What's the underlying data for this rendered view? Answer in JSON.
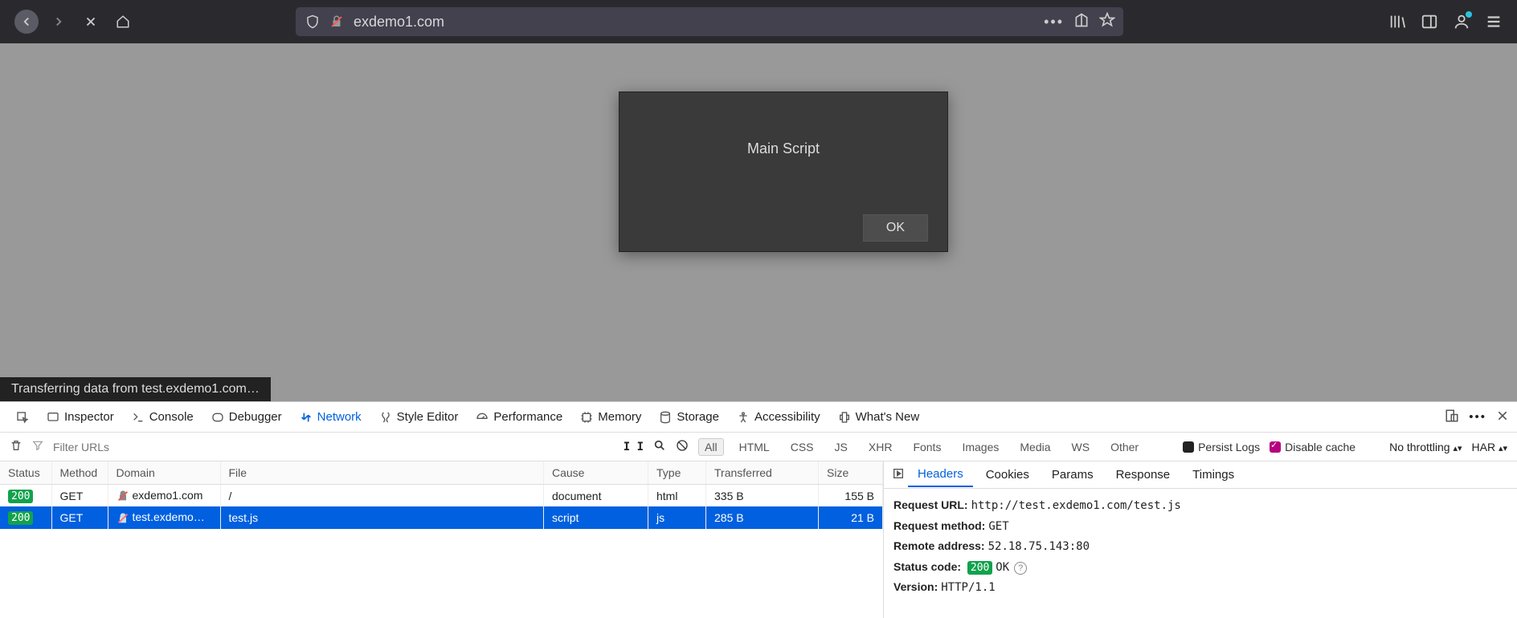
{
  "browser": {
    "url": "exdemo1.com",
    "status_text": "Transferring data from test.exdemo1.com…"
  },
  "dialog": {
    "message": "Main Script",
    "ok_label": "OK"
  },
  "devtools": {
    "tabs": {
      "inspector": "Inspector",
      "console": "Console",
      "debugger": "Debugger",
      "network": "Network",
      "style_editor": "Style Editor",
      "performance": "Performance",
      "memory": "Memory",
      "storage": "Storage",
      "accessibility": "Accessibility",
      "whats_new": "What's New"
    },
    "net_toolbar": {
      "filter_placeholder": "Filter URLs",
      "chips": {
        "all": "All",
        "html": "HTML",
        "css": "CSS",
        "js": "JS",
        "xhr": "XHR",
        "fonts": "Fonts",
        "images": "Images",
        "media": "Media",
        "ws": "WS",
        "other": "Other"
      },
      "persist_logs": "Persist Logs",
      "disable_cache": "Disable cache",
      "throttling": "No throttling",
      "har": "HAR"
    },
    "columns": {
      "status": "Status",
      "method": "Method",
      "domain": "Domain",
      "file": "File",
      "cause": "Cause",
      "type": "Type",
      "transferred": "Transferred",
      "size": "Size"
    },
    "rows": [
      {
        "status": "200",
        "method": "GET",
        "domain": "exdemo1.com",
        "file": "/",
        "cause": "document",
        "type": "html",
        "transferred": "335 B",
        "size": "155 B"
      },
      {
        "status": "200",
        "method": "GET",
        "domain": "test.exdemo…",
        "file": "test.js",
        "cause": "script",
        "type": "js",
        "transferred": "285 B",
        "size": "21 B"
      }
    ],
    "detail_tabs": {
      "headers": "Headers",
      "cookies": "Cookies",
      "params": "Params",
      "response": "Response",
      "timings": "Timings"
    },
    "details": {
      "request_url_label": "Request URL:",
      "request_url": "http://test.exdemo1.com/test.js",
      "request_method_label": "Request method:",
      "request_method": "GET",
      "remote_address_label": "Remote address:",
      "remote_address": "52.18.75.143:80",
      "status_code_label": "Status code:",
      "status_code": "200",
      "status_text": "OK",
      "version_label": "Version:",
      "version": "HTTP/1.1"
    }
  }
}
